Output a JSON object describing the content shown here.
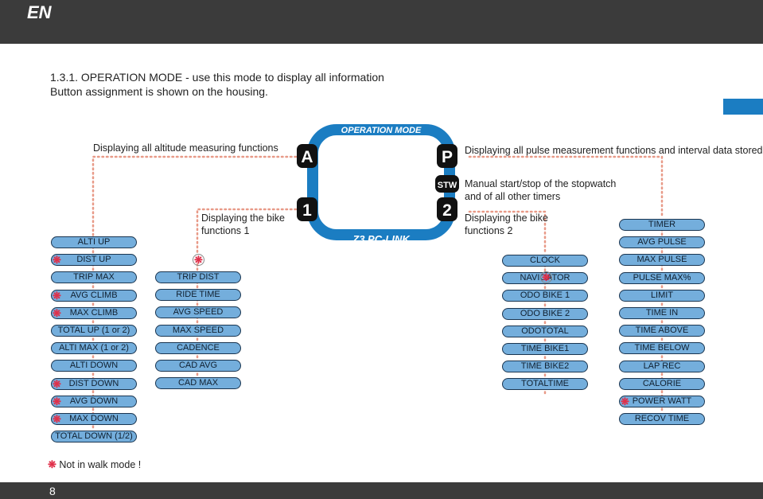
{
  "header": {
    "lang": "EN"
  },
  "footer": {
    "page": "8"
  },
  "intro": {
    "line1": "1.3.1. OPERATION MODE - use this mode to display all information",
    "line2": "Button assignment is shown on the housing."
  },
  "device": {
    "top_label": "OPERATION MODE",
    "bottom_label": "Z3 PC-LINK",
    "buttons": [
      "A",
      "1",
      "P",
      "STW",
      "2"
    ]
  },
  "annotations": {
    "altitude": "Displaying all altitude measuring functions",
    "pulse": "Displaying all pulse measurement functions and interval data stored",
    "stw1": "Manual start/stop of the stopwatch",
    "stw2": "and of all other timers",
    "bike1a": "Displaying the bike",
    "bike1b": "functions 1",
    "bike2a": "Displaying the bike",
    "bike2b": "functions 2"
  },
  "columns": {
    "altitude": [
      {
        "label": "ALTI UP",
        "ast": false
      },
      {
        "label": "DIST UP",
        "ast": true
      },
      {
        "label": "TRIP MAX",
        "ast": false
      },
      {
        "label": "AVG CLIMB",
        "ast": true
      },
      {
        "label": "MAX CLIMB",
        "ast": true
      },
      {
        "label": "TOTAL UP (1 or 2)",
        "ast": false
      },
      {
        "label": "ALTI MAX (1 or 2)",
        "ast": false
      },
      {
        "label": "ALTI DOWN",
        "ast": false
      },
      {
        "label": "DIST DOWN",
        "ast": true
      },
      {
        "label": "AVG DOWN",
        "ast": true
      },
      {
        "label": "MAX DOWN",
        "ast": true
      },
      {
        "label": "TOTAL DOWN (1/2)",
        "ast": false
      }
    ],
    "bike1": [
      {
        "label": "TRIP DIST"
      },
      {
        "label": "RIDE TIME"
      },
      {
        "label": "AVG SPEED"
      },
      {
        "label": "MAX SPEED"
      },
      {
        "label": "CADENCE"
      },
      {
        "label": "CAD AVG"
      },
      {
        "label": "CAD MAX"
      }
    ],
    "bike2": [
      {
        "label": "CLOCK"
      },
      {
        "label": "NAVIGATOR"
      },
      {
        "label": "ODO BIKE 1"
      },
      {
        "label": "ODO BIKE 2"
      },
      {
        "label": "ODOTOTAL"
      },
      {
        "label": "TIME BIKE1"
      },
      {
        "label": "TIME BIKE2"
      },
      {
        "label": "TOTALTIME"
      }
    ],
    "pulse": [
      {
        "label": "TIMER",
        "ast": false
      },
      {
        "label": "AVG PULSE",
        "ast": false
      },
      {
        "label": "MAX PULSE",
        "ast": false
      },
      {
        "label": "PULSE MAX%",
        "ast": false
      },
      {
        "label": "LIMIT",
        "ast": false
      },
      {
        "label": "TIME IN",
        "ast": false
      },
      {
        "label": "TIME ABOVE",
        "ast": false
      },
      {
        "label": "TIME BELOW",
        "ast": false
      },
      {
        "label": "LAP REC",
        "ast": false
      },
      {
        "label": "CALORIE",
        "ast": false
      },
      {
        "label": "POWER WATT",
        "ast": true
      },
      {
        "label": "RECOV TIME",
        "ast": false
      }
    ]
  },
  "legend": {
    "symbol": "❋",
    "text": "Not in walk mode !"
  },
  "colors": {
    "accent": "#1b7dc2",
    "pill": "#74aedc",
    "dots": "#e89a88",
    "asterisk": "#e0304a",
    "bar": "#3b3b3b"
  }
}
